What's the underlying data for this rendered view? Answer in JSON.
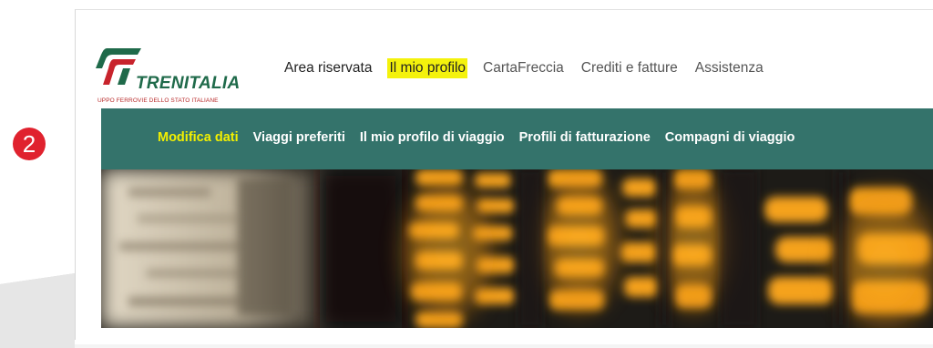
{
  "step": {
    "number": "2",
    "color": "#e0222e"
  },
  "brand": {
    "name": "TRENITALIA",
    "tagline": "UPPO FERROVIE DELLO STATO ITALIANE",
    "green": "#1f6a4a",
    "red": "#c8232c"
  },
  "top_nav": {
    "items": [
      {
        "label": "Area riservata",
        "highlighted": false
      },
      {
        "label": "Il mio profilo",
        "highlighted": true
      },
      {
        "label": "CartaFreccia",
        "highlighted": false
      },
      {
        "label": "Crediti e fatture",
        "highlighted": false
      },
      {
        "label": "Assistenza",
        "highlighted": false
      }
    ],
    "highlight_color": "#f4f20c"
  },
  "sub_nav": {
    "background": "#34736b",
    "items": [
      {
        "label": "Modifica dati",
        "active": true
      },
      {
        "label": "Viaggi preferiti",
        "active": false
      },
      {
        "label": "Il mio profilo di viaggio",
        "active": false
      },
      {
        "label": "Profili di fatturazione",
        "active": false
      },
      {
        "label": "Compagni di viaggio",
        "active": false
      }
    ]
  },
  "hero": {
    "image": "blurred-departure-board"
  }
}
